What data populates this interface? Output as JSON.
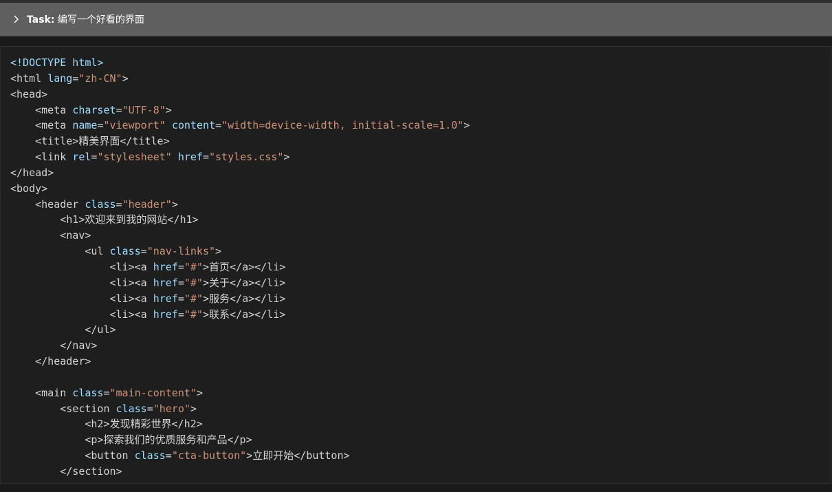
{
  "task": {
    "label": "Task:",
    "title": "编写一个好看的界面"
  },
  "code_lines": [
    [
      [
        "doctype",
        "<!DOCTYPE html>"
      ]
    ],
    [
      [
        "tag",
        "<html "
      ],
      [
        "attr",
        "lang"
      ],
      [
        "tag",
        "="
      ],
      [
        "str",
        "\"zh-CN\""
      ],
      [
        "tag",
        ">"
      ]
    ],
    [
      [
        "tag",
        "<head>"
      ]
    ],
    [
      [
        "tag",
        "    <meta "
      ],
      [
        "attr",
        "charset"
      ],
      [
        "tag",
        "="
      ],
      [
        "str",
        "\"UTF-8\""
      ],
      [
        "tag",
        ">"
      ]
    ],
    [
      [
        "tag",
        "    <meta "
      ],
      [
        "attr",
        "name"
      ],
      [
        "tag",
        "="
      ],
      [
        "str",
        "\"viewport\""
      ],
      [
        "tag",
        " "
      ],
      [
        "attr",
        "content"
      ],
      [
        "tag",
        "="
      ],
      [
        "str",
        "\"width=device-width, initial-scale=1.0\""
      ],
      [
        "tag",
        ">"
      ]
    ],
    [
      [
        "tag",
        "    <title>"
      ],
      [
        "text",
        "精美界面"
      ],
      [
        "tag",
        "</title>"
      ]
    ],
    [
      [
        "tag",
        "    <link "
      ],
      [
        "attr",
        "rel"
      ],
      [
        "tag",
        "="
      ],
      [
        "str",
        "\"stylesheet\""
      ],
      [
        "tag",
        " "
      ],
      [
        "attr",
        "href"
      ],
      [
        "tag",
        "="
      ],
      [
        "str",
        "\"styles.css\""
      ],
      [
        "tag",
        ">"
      ]
    ],
    [
      [
        "tag",
        "</head>"
      ]
    ],
    [
      [
        "tag",
        "<body>"
      ]
    ],
    [
      [
        "tag",
        "    <header "
      ],
      [
        "attr",
        "class"
      ],
      [
        "tag",
        "="
      ],
      [
        "str",
        "\"header\""
      ],
      [
        "tag",
        ">"
      ]
    ],
    [
      [
        "tag",
        "        <h1>"
      ],
      [
        "text",
        "欢迎来到我的网站"
      ],
      [
        "tag",
        "</h1>"
      ]
    ],
    [
      [
        "tag",
        "        <nav>"
      ]
    ],
    [
      [
        "tag",
        "            <ul "
      ],
      [
        "attr",
        "class"
      ],
      [
        "tag",
        "="
      ],
      [
        "str",
        "\"nav-links\""
      ],
      [
        "tag",
        ">"
      ]
    ],
    [
      [
        "tag",
        "                <li><a "
      ],
      [
        "attr",
        "href"
      ],
      [
        "tag",
        "="
      ],
      [
        "str",
        "\"#\""
      ],
      [
        "tag",
        ">"
      ],
      [
        "text",
        "首页"
      ],
      [
        "tag",
        "</a></li>"
      ]
    ],
    [
      [
        "tag",
        "                <li><a "
      ],
      [
        "attr",
        "href"
      ],
      [
        "tag",
        "="
      ],
      [
        "str",
        "\"#\""
      ],
      [
        "tag",
        ">"
      ],
      [
        "text",
        "关于"
      ],
      [
        "tag",
        "</a></li>"
      ]
    ],
    [
      [
        "tag",
        "                <li><a "
      ],
      [
        "attr",
        "href"
      ],
      [
        "tag",
        "="
      ],
      [
        "str",
        "\"#\""
      ],
      [
        "tag",
        ">"
      ],
      [
        "text",
        "服务"
      ],
      [
        "tag",
        "</a></li>"
      ]
    ],
    [
      [
        "tag",
        "                <li><a "
      ],
      [
        "attr",
        "href"
      ],
      [
        "tag",
        "="
      ],
      [
        "str",
        "\"#\""
      ],
      [
        "tag",
        ">"
      ],
      [
        "text",
        "联系"
      ],
      [
        "tag",
        "</a></li>"
      ]
    ],
    [
      [
        "tag",
        "            </ul>"
      ]
    ],
    [
      [
        "tag",
        "        </nav>"
      ]
    ],
    [
      [
        "tag",
        "    </header>"
      ]
    ],
    [
      [
        "tag",
        ""
      ]
    ],
    [
      [
        "tag",
        "    <main "
      ],
      [
        "attr",
        "class"
      ],
      [
        "tag",
        "="
      ],
      [
        "str",
        "\"main-content\""
      ],
      [
        "tag",
        ">"
      ]
    ],
    [
      [
        "tag",
        "        <section "
      ],
      [
        "attr",
        "class"
      ],
      [
        "tag",
        "="
      ],
      [
        "str",
        "\"hero\""
      ],
      [
        "tag",
        ">"
      ]
    ],
    [
      [
        "tag",
        "            <h2>"
      ],
      [
        "text",
        "发现精彩世界"
      ],
      [
        "tag",
        "</h2>"
      ]
    ],
    [
      [
        "tag",
        "            <p>"
      ],
      [
        "text",
        "探索我们的优质服务和产品"
      ],
      [
        "tag",
        "</p>"
      ]
    ],
    [
      [
        "tag",
        "            <button "
      ],
      [
        "attr",
        "class"
      ],
      [
        "tag",
        "="
      ],
      [
        "str",
        "\"cta-button\""
      ],
      [
        "tag",
        ">"
      ],
      [
        "text",
        "立即开始"
      ],
      [
        "tag",
        "</button>"
      ]
    ],
    [
      [
        "tag",
        "        </section>"
      ]
    ]
  ]
}
